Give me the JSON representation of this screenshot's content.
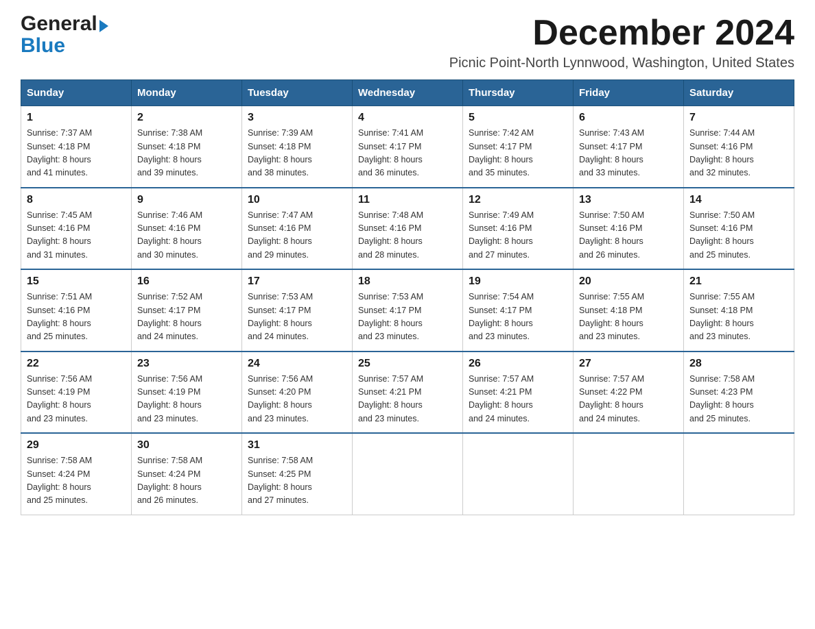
{
  "logo": {
    "line1": "General",
    "line2": "Blue"
  },
  "header": {
    "title": "December 2024",
    "subtitle": "Picnic Point-North Lynnwood, Washington, United States"
  },
  "weekdays": [
    "Sunday",
    "Monday",
    "Tuesday",
    "Wednesday",
    "Thursday",
    "Friday",
    "Saturday"
  ],
  "weeks": [
    [
      {
        "day": "1",
        "sunrise": "7:37 AM",
        "sunset": "4:18 PM",
        "daylight": "8 hours and 41 minutes."
      },
      {
        "day": "2",
        "sunrise": "7:38 AM",
        "sunset": "4:18 PM",
        "daylight": "8 hours and 39 minutes."
      },
      {
        "day": "3",
        "sunrise": "7:39 AM",
        "sunset": "4:18 PM",
        "daylight": "8 hours and 38 minutes."
      },
      {
        "day": "4",
        "sunrise": "7:41 AM",
        "sunset": "4:17 PM",
        "daylight": "8 hours and 36 minutes."
      },
      {
        "day": "5",
        "sunrise": "7:42 AM",
        "sunset": "4:17 PM",
        "daylight": "8 hours and 35 minutes."
      },
      {
        "day": "6",
        "sunrise": "7:43 AM",
        "sunset": "4:17 PM",
        "daylight": "8 hours and 33 minutes."
      },
      {
        "day": "7",
        "sunrise": "7:44 AM",
        "sunset": "4:16 PM",
        "daylight": "8 hours and 32 minutes."
      }
    ],
    [
      {
        "day": "8",
        "sunrise": "7:45 AM",
        "sunset": "4:16 PM",
        "daylight": "8 hours and 31 minutes."
      },
      {
        "day": "9",
        "sunrise": "7:46 AM",
        "sunset": "4:16 PM",
        "daylight": "8 hours and 30 minutes."
      },
      {
        "day": "10",
        "sunrise": "7:47 AM",
        "sunset": "4:16 PM",
        "daylight": "8 hours and 29 minutes."
      },
      {
        "day": "11",
        "sunrise": "7:48 AM",
        "sunset": "4:16 PM",
        "daylight": "8 hours and 28 minutes."
      },
      {
        "day": "12",
        "sunrise": "7:49 AM",
        "sunset": "4:16 PM",
        "daylight": "8 hours and 27 minutes."
      },
      {
        "day": "13",
        "sunrise": "7:50 AM",
        "sunset": "4:16 PM",
        "daylight": "8 hours and 26 minutes."
      },
      {
        "day": "14",
        "sunrise": "7:50 AM",
        "sunset": "4:16 PM",
        "daylight": "8 hours and 25 minutes."
      }
    ],
    [
      {
        "day": "15",
        "sunrise": "7:51 AM",
        "sunset": "4:16 PM",
        "daylight": "8 hours and 25 minutes."
      },
      {
        "day": "16",
        "sunrise": "7:52 AM",
        "sunset": "4:17 PM",
        "daylight": "8 hours and 24 minutes."
      },
      {
        "day": "17",
        "sunrise": "7:53 AM",
        "sunset": "4:17 PM",
        "daylight": "8 hours and 24 minutes."
      },
      {
        "day": "18",
        "sunrise": "7:53 AM",
        "sunset": "4:17 PM",
        "daylight": "8 hours and 23 minutes."
      },
      {
        "day": "19",
        "sunrise": "7:54 AM",
        "sunset": "4:17 PM",
        "daylight": "8 hours and 23 minutes."
      },
      {
        "day": "20",
        "sunrise": "7:55 AM",
        "sunset": "4:18 PM",
        "daylight": "8 hours and 23 minutes."
      },
      {
        "day": "21",
        "sunrise": "7:55 AM",
        "sunset": "4:18 PM",
        "daylight": "8 hours and 23 minutes."
      }
    ],
    [
      {
        "day": "22",
        "sunrise": "7:56 AM",
        "sunset": "4:19 PM",
        "daylight": "8 hours and 23 minutes."
      },
      {
        "day": "23",
        "sunrise": "7:56 AM",
        "sunset": "4:19 PM",
        "daylight": "8 hours and 23 minutes."
      },
      {
        "day": "24",
        "sunrise": "7:56 AM",
        "sunset": "4:20 PM",
        "daylight": "8 hours and 23 minutes."
      },
      {
        "day": "25",
        "sunrise": "7:57 AM",
        "sunset": "4:21 PM",
        "daylight": "8 hours and 23 minutes."
      },
      {
        "day": "26",
        "sunrise": "7:57 AM",
        "sunset": "4:21 PM",
        "daylight": "8 hours and 24 minutes."
      },
      {
        "day": "27",
        "sunrise": "7:57 AM",
        "sunset": "4:22 PM",
        "daylight": "8 hours and 24 minutes."
      },
      {
        "day": "28",
        "sunrise": "7:58 AM",
        "sunset": "4:23 PM",
        "daylight": "8 hours and 25 minutes."
      }
    ],
    [
      {
        "day": "29",
        "sunrise": "7:58 AM",
        "sunset": "4:24 PM",
        "daylight": "8 hours and 25 minutes."
      },
      {
        "day": "30",
        "sunrise": "7:58 AM",
        "sunset": "4:24 PM",
        "daylight": "8 hours and 26 minutes."
      },
      {
        "day": "31",
        "sunrise": "7:58 AM",
        "sunset": "4:25 PM",
        "daylight": "8 hours and 27 minutes."
      },
      null,
      null,
      null,
      null
    ]
  ]
}
